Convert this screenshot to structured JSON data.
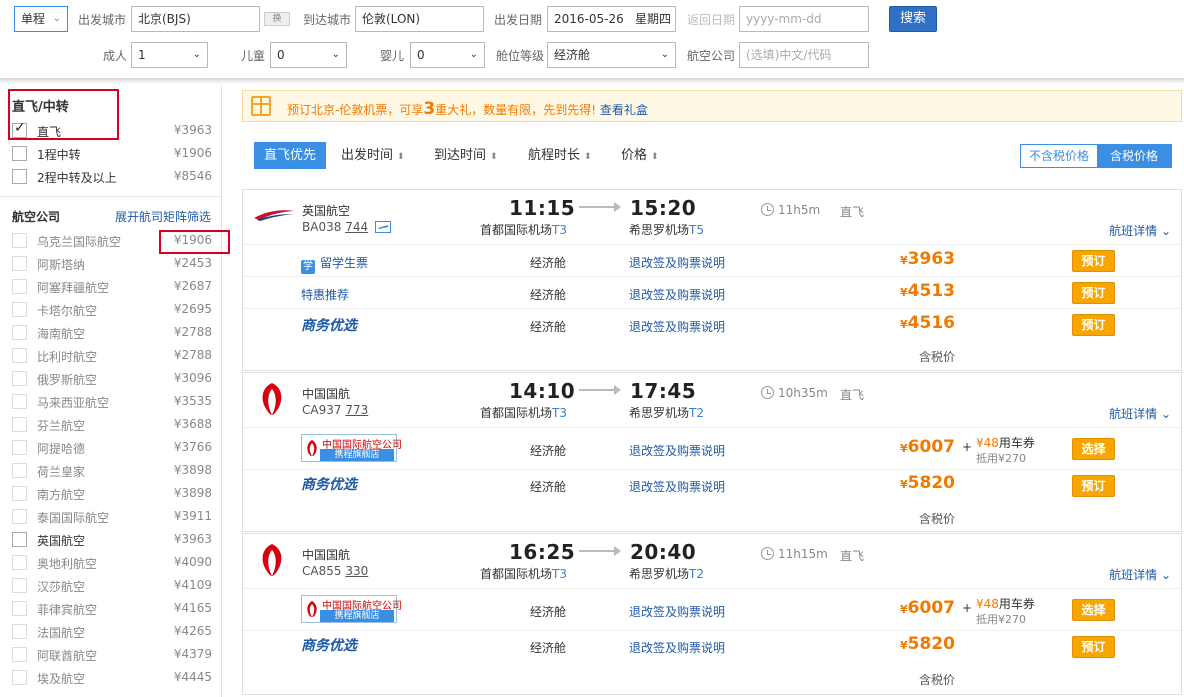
{
  "search": {
    "trip_type": "单程",
    "from_label": "出发城市",
    "from_value": "北京(BJS)",
    "swap": "换",
    "to_label": "到达城市",
    "to_value": "伦敦(LON)",
    "depart_label": "出发日期",
    "depart_value": "2016-05-26",
    "depart_weekday": "星期四",
    "return_label": "返回日期",
    "return_placeholder": "yyyy-mm-dd",
    "search_button": "搜索",
    "adult_label": "成人",
    "adult_value": "1",
    "child_label": "儿童",
    "child_value": "0",
    "infant_label": "婴儿",
    "infant_value": "0",
    "cabin_label": "舱位等级",
    "cabin_value": "经济舱",
    "airline_label": "航空公司",
    "airline_placeholder": "(选填)中文/代码"
  },
  "sidebar": {
    "stops_title": "直飞/中转",
    "stops": [
      {
        "label": "直飞",
        "price": "¥3963",
        "checked": true
      },
      {
        "label": "1程中转",
        "price": "¥1906",
        "checked": false
      },
      {
        "label": "2程中转及以上",
        "price": "¥8546",
        "checked": false
      }
    ],
    "airlines_title": "航空公司",
    "airlines_link": "展开航司矩阵筛选",
    "airlines": [
      {
        "label": "乌克兰国际航空",
        "price": "¥1906",
        "enabled": false
      },
      {
        "label": "阿斯塔纳",
        "price": "¥2453",
        "enabled": false
      },
      {
        "label": "阿塞拜疆航空",
        "price": "¥2687",
        "enabled": false
      },
      {
        "label": "卡塔尔航空",
        "price": "¥2695",
        "enabled": false
      },
      {
        "label": "海南航空",
        "price": "¥2788",
        "enabled": false
      },
      {
        "label": "比利时航空",
        "price": "¥2788",
        "enabled": false
      },
      {
        "label": "俄罗斯航空",
        "price": "¥3096",
        "enabled": false
      },
      {
        "label": "马来西亚航空",
        "price": "¥3535",
        "enabled": false
      },
      {
        "label": "芬兰航空",
        "price": "¥3688",
        "enabled": false
      },
      {
        "label": "阿提哈德",
        "price": "¥3766",
        "enabled": false
      },
      {
        "label": "荷兰皇家",
        "price": "¥3898",
        "enabled": false
      },
      {
        "label": "南方航空",
        "price": "¥3898",
        "enabled": false
      },
      {
        "label": "泰国国际航空",
        "price": "¥3911",
        "enabled": false
      },
      {
        "label": "英国航空",
        "price": "¥3963",
        "enabled": true
      },
      {
        "label": "奥地利航空",
        "price": "¥4090",
        "enabled": false
      },
      {
        "label": "汉莎航空",
        "price": "¥4109",
        "enabled": false
      },
      {
        "label": "菲律宾航空",
        "price": "¥4165",
        "enabled": false
      },
      {
        "label": "法国航空",
        "price": "¥4265",
        "enabled": false
      },
      {
        "label": "阿联酋航空",
        "price": "¥4379",
        "enabled": false
      },
      {
        "label": "埃及航空",
        "price": "¥4445",
        "enabled": false
      }
    ]
  },
  "promo": {
    "text_before": "预订北京-伦敦机票，可享",
    "number": "3",
    "text_after": "重大礼，数量有限，先到先得!",
    "link": "查看礼盒"
  },
  "sort": {
    "direct_first": "直飞优先",
    "depart_time": "出发时间",
    "arrive_time": "到达时间",
    "duration": "航程时长",
    "price": "价格",
    "excl_tax": "不含税价格",
    "incl_tax": "含税价格"
  },
  "flights": [
    {
      "airline": "英国航空",
      "flight_no": "BA038",
      "aircraft": "744",
      "dep_time": "11:15",
      "dep_airport": "首都国际机场",
      "dep_terminal": "T3",
      "arr_time": "15:20",
      "arr_airport": "希思罗机场",
      "arr_terminal": "T5",
      "duration": "11h5m",
      "direct": "直飞",
      "details": "航班详情 ⌄",
      "fares": [
        {
          "label": "留学生票",
          "cabin": "经济舱",
          "refund": "退改签及购票说明",
          "price": "3963",
          "action": "预订"
        },
        {
          "label": "特惠推荐",
          "cabin": "经济舱",
          "refund": "退改签及购票说明",
          "price": "4513",
          "action": "预订"
        },
        {
          "label": "商务优选",
          "cabin": "经济舱",
          "refund": "退改签及购票说明",
          "price": "4516",
          "action": "预订"
        }
      ],
      "tax_note": "含税价"
    },
    {
      "airline": "中国国航",
      "flight_no": "CA937",
      "aircraft": "773",
      "dep_time": "14:10",
      "dep_airport": "首都国际机场",
      "dep_terminal": "T3",
      "arr_time": "17:45",
      "arr_airport": "希思罗机场",
      "arr_terminal": "T2",
      "duration": "10h35m",
      "direct": "直飞",
      "details": "航班详情 ⌄",
      "fares": [
        {
          "label": "中国国际航空公司 携程旗舰店",
          "cabin": "经济舱",
          "refund": "退改签及购票说明",
          "price": "6007",
          "coupon": "¥48用车券",
          "coupon_value": "¥48",
          "coupon_suffix": "用车券",
          "offset": "抵用¥270",
          "action": "选择"
        },
        {
          "label": "商务优选",
          "cabin": "经济舱",
          "refund": "退改签及购票说明",
          "price": "5820",
          "action": "预订"
        }
      ],
      "tax_note": "含税价"
    },
    {
      "airline": "中国国航",
      "flight_no": "CA855",
      "aircraft": "330",
      "dep_time": "16:25",
      "dep_airport": "首都国际机场",
      "dep_terminal": "T3",
      "arr_time": "20:40",
      "arr_airport": "希思罗机场",
      "arr_terminal": "T2",
      "duration": "11h15m",
      "direct": "直飞",
      "details": "航班详情 ⌄",
      "fares": [
        {
          "label": "中国国际航空公司 携程旗舰店",
          "cabin": "经济舱",
          "refund": "退改签及购票说明",
          "price": "6007",
          "coupon_value": "¥48",
          "coupon_suffix": "用车券",
          "offset": "抵用¥270",
          "action": "选择"
        },
        {
          "label": "商务优选",
          "cabin": "经济舱",
          "refund": "退改签及购票说明",
          "price": "5820",
          "action": "预订"
        }
      ],
      "tax_note": "含税价"
    }
  ],
  "brand": {
    "flag_top": "中国国际航空公司",
    "flag_bottom": "携程旗舰店",
    "student_badge": "学",
    "currency": "¥"
  },
  "colors": {
    "accent": "#3a8fe3",
    "price": "#f07a00",
    "book": "#f7a600",
    "link": "#1f5aa8",
    "highlight": "#d9001b"
  }
}
